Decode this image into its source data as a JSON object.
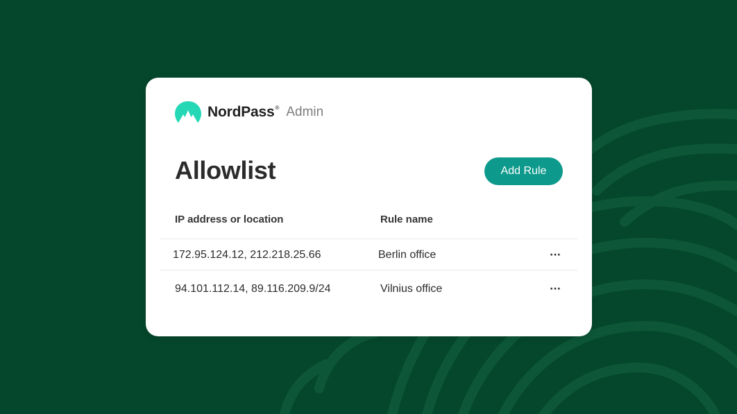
{
  "brand": {
    "name": "NordPass",
    "registered_mark": "®",
    "section": "Admin",
    "logo_icon": "nordpass-mountain-logo-icon"
  },
  "page": {
    "title": "Allowlist"
  },
  "actions": {
    "add_rule_label": "Add Rule"
  },
  "table": {
    "columns": [
      "IP address or location",
      "Rule name"
    ],
    "rows": [
      {
        "ip": "172.95.124.12, 212.218.25.66",
        "name": "Berlin office",
        "menu": "···"
      },
      {
        "ip": "94.101.112.14, 89.116.209.9/24",
        "name": "Vilnius office",
        "menu": "···"
      }
    ]
  },
  "colors": {
    "background": "#05472c",
    "accent": "#0d9a8c",
    "logo": "#24d8b5",
    "card": "#ffffff"
  }
}
